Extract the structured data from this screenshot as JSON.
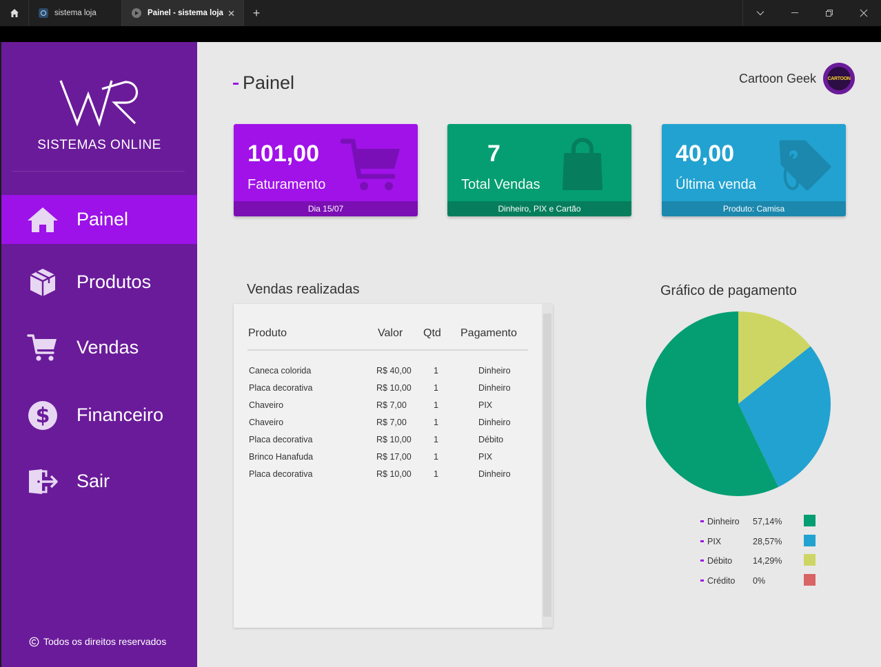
{
  "browser": {
    "tabs": [
      {
        "label": "sistema loja",
        "active": false
      },
      {
        "label": "Painel - sistema loja",
        "active": true
      }
    ],
    "new_tab_symbol": "+",
    "close_symbol": "✕"
  },
  "sidebar": {
    "brand": "SISTEMAS ONLINE",
    "items": [
      {
        "label": "Painel",
        "icon": "home-icon",
        "active": true
      },
      {
        "label": "Produtos",
        "icon": "box-icon",
        "active": false
      },
      {
        "label": "Vendas",
        "icon": "cart-icon",
        "active": false
      },
      {
        "label": "Financeiro",
        "icon": "dollar-icon",
        "active": false
      },
      {
        "label": "Sair",
        "icon": "exit-icon",
        "active": false
      }
    ],
    "footer": "Todos os direitos reservados"
  },
  "header": {
    "title": "Painel",
    "user_name": "Cartoon Geek",
    "avatar_text": "CARTOON"
  },
  "cards": [
    {
      "value": "101,00",
      "label": "Faturamento",
      "footer": "Dia 15/07",
      "color": "#a012e8",
      "strip": "#7b0fb3",
      "icon": "cart-icon"
    },
    {
      "value": "7",
      "label": "Total Vendas",
      "footer": "Dinheiro, PIX e Cartão",
      "color": "#049e72",
      "strip": "#067e5d",
      "icon": "shopping-bag-icon"
    },
    {
      "value": "40,00",
      "label": "Última venda",
      "footer": "Produto: Camisa",
      "color": "#22a2d0",
      "strip": "#1c88ae",
      "icon": "price-tag-icon"
    }
  ],
  "sales": {
    "title": "Vendas realizadas",
    "columns": [
      "Produto",
      "Valor",
      "Qtd",
      "Pagamento"
    ],
    "rows": [
      [
        "Caneca colorida",
        "R$ 40,00",
        "1",
        "Dinheiro"
      ],
      [
        "Placa decorativa",
        "R$ 10,00",
        "1",
        "Dinheiro"
      ],
      [
        "Chaveiro",
        "R$ 7,00",
        "1",
        "PIX"
      ],
      [
        "Chaveiro",
        "R$ 7,00",
        "1",
        "Dinheiro"
      ],
      [
        "Placa decorativa",
        "R$ 10,00",
        "1",
        "Débito"
      ],
      [
        "Brinco Hanafuda",
        "R$ 17,00",
        "1",
        "PIX"
      ],
      [
        "Placa decorativa",
        "R$ 10,00",
        "1",
        "Dinheiro"
      ]
    ]
  },
  "payment_chart": {
    "title": "Gráfico de pagamento",
    "legend": [
      {
        "name": "Dinheiro",
        "pct": "57,14%",
        "color": "#049e72"
      },
      {
        "name": "PIX",
        "pct": "28,57%",
        "color": "#22a2d0"
      },
      {
        "name": "Débito",
        "pct": "14,29%",
        "color": "#cdd662"
      },
      {
        "name": "Crédito",
        "pct": "0%",
        "color": "#d96464"
      }
    ]
  },
  "chart_data": {
    "type": "pie",
    "title": "Gráfico de pagamento",
    "categories": [
      "Dinheiro",
      "PIX",
      "Débito",
      "Crédito"
    ],
    "values": [
      57.14,
      28.57,
      14.29,
      0
    ],
    "colors": [
      "#049e72",
      "#22a2d0",
      "#cdd662",
      "#d96464"
    ],
    "legend": "bottom"
  }
}
